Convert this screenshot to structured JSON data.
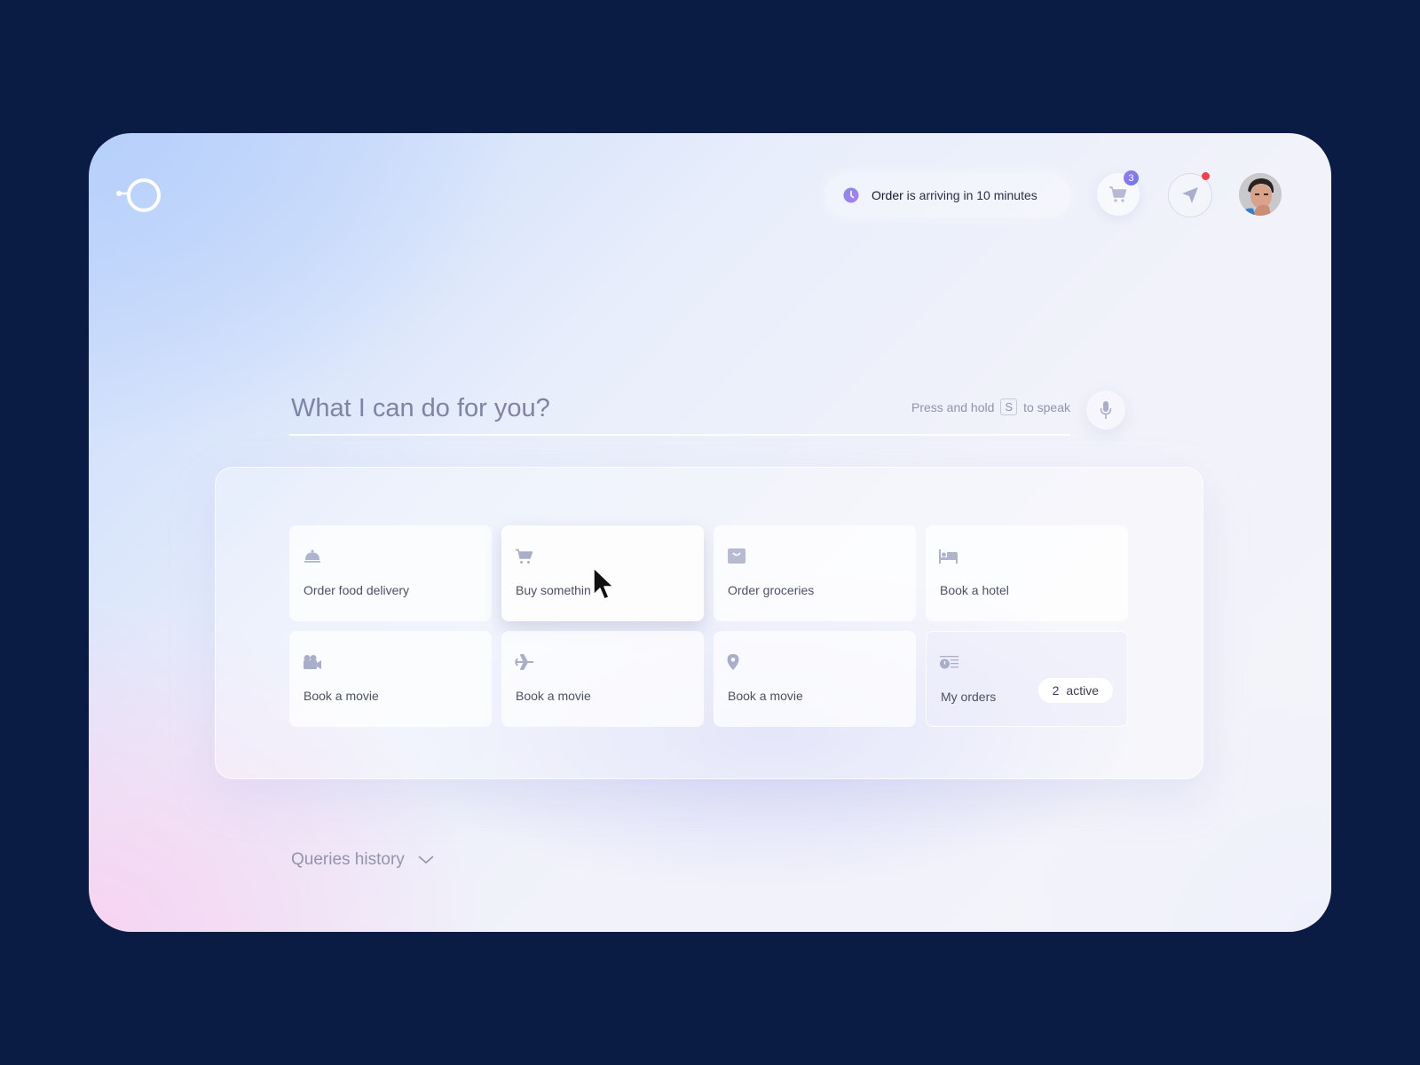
{
  "header": {
    "logo": "assistant-logo",
    "notification": {
      "bold": "Order",
      "text": " is arriving in 10 minutes",
      "icon": "clock-icon"
    },
    "cart": {
      "icon": "cart-icon",
      "badge": "3"
    },
    "send": {
      "icon": "send-icon",
      "has_dot": true
    },
    "avatar": "user-avatar"
  },
  "search": {
    "placeholder": "What I can do for you?",
    "hint_prefix": "Press and hold",
    "hint_key": "S",
    "hint_suffix": "to speak",
    "mic_icon": "microphone-icon"
  },
  "tiles": [
    {
      "label": "Order food delivery",
      "icon": "food-cloche-icon"
    },
    {
      "label": "Buy somethin",
      "icon": "cart-icon",
      "state": "hover"
    },
    {
      "label": "Order groceries",
      "icon": "grocery-bag-icon"
    },
    {
      "label": "Book a hotel",
      "icon": "bed-icon"
    },
    {
      "label": "Book a movie",
      "icon": "video-camera-icon"
    },
    {
      "label": "Book a movie",
      "icon": "airplane-icon"
    },
    {
      "label": "Book a movie",
      "icon": "location-pin-icon"
    },
    {
      "label": "My orders",
      "icon": "orders-list-icon",
      "badge_count": "2",
      "badge_text": "active"
    }
  ],
  "history": {
    "label": "Queries history",
    "icon": "chevron-down-icon"
  },
  "colors": {
    "frame_bg": "#0a1c44",
    "accent_purple": "#8a78ee",
    "notification_dot": "#f0404b",
    "icon_gray": "#a9aec9",
    "text_dark": "#4b5066"
  }
}
